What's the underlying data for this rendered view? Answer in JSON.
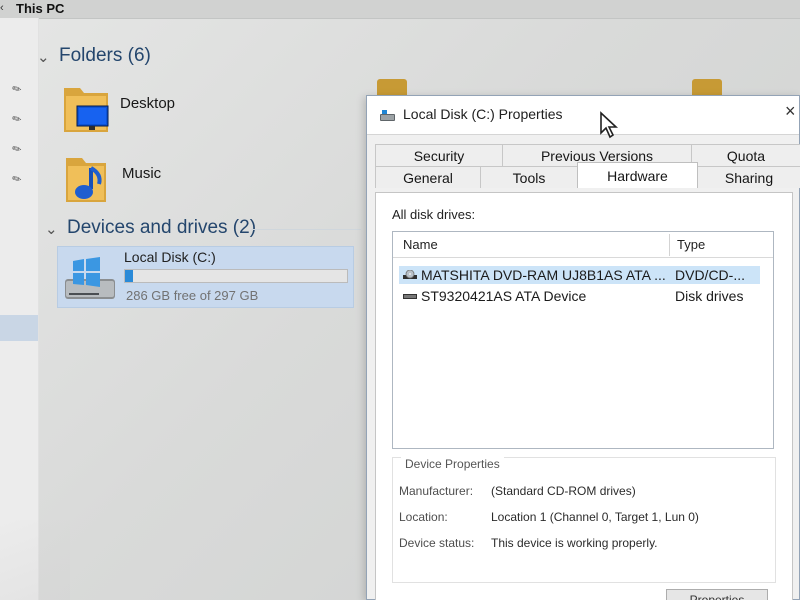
{
  "window": {
    "title": "This PC",
    "back_icon": "chevron-left-icon"
  },
  "folders": {
    "header": "Folders (6)",
    "items": [
      {
        "label": "Desktop",
        "icon": "desktop-folder-icon"
      },
      {
        "label": "Music",
        "icon": "music-folder-icon"
      }
    ]
  },
  "devices": {
    "header": "Devices and drives (2)",
    "drive": {
      "label": "Local Disk (C:)",
      "free_text": "286 GB free of 297 GB",
      "used_fraction": 0.037,
      "icon": "windows-drive-icon"
    }
  },
  "dialog": {
    "title": "Local Disk (C:) Properties",
    "icon": "drive-icon",
    "close_symbol": "×",
    "tabs": {
      "row1": [
        "Security",
        "Previous Versions",
        "Quota"
      ],
      "row2": [
        "General",
        "Tools",
        "Hardware",
        "Sharing"
      ],
      "active": "Hardware"
    },
    "hardware": {
      "all_disk_drives_label": "All disk drives:",
      "columns": [
        "Name",
        "Type"
      ],
      "rows": [
        {
          "name": "MATSHITA DVD-RAM UJ8B1AS ATA ...",
          "type": "DVD/CD-...",
          "icon": "dvd-drive-icon",
          "selected": true
        },
        {
          "name": "ST9320421AS ATA Device",
          "type": "Disk drives",
          "icon": "disk-drive-icon",
          "selected": false
        }
      ],
      "device_properties": {
        "title": "Device Properties",
        "manufacturer_label": "Manufacturer:",
        "manufacturer_value": "(Standard CD-ROM drives)",
        "location_label": "Location:",
        "location_value": "Location 1 (Channel 0, Target 1, Lun 0)",
        "status_label": "Device status:",
        "status_value": "This device is working properly."
      },
      "properties_button": "Properties"
    }
  },
  "colors": {
    "accent": "#2a8ad8",
    "selection": "#cce4f8",
    "header_text": "#24466d",
    "folder": "#d9a53d"
  }
}
